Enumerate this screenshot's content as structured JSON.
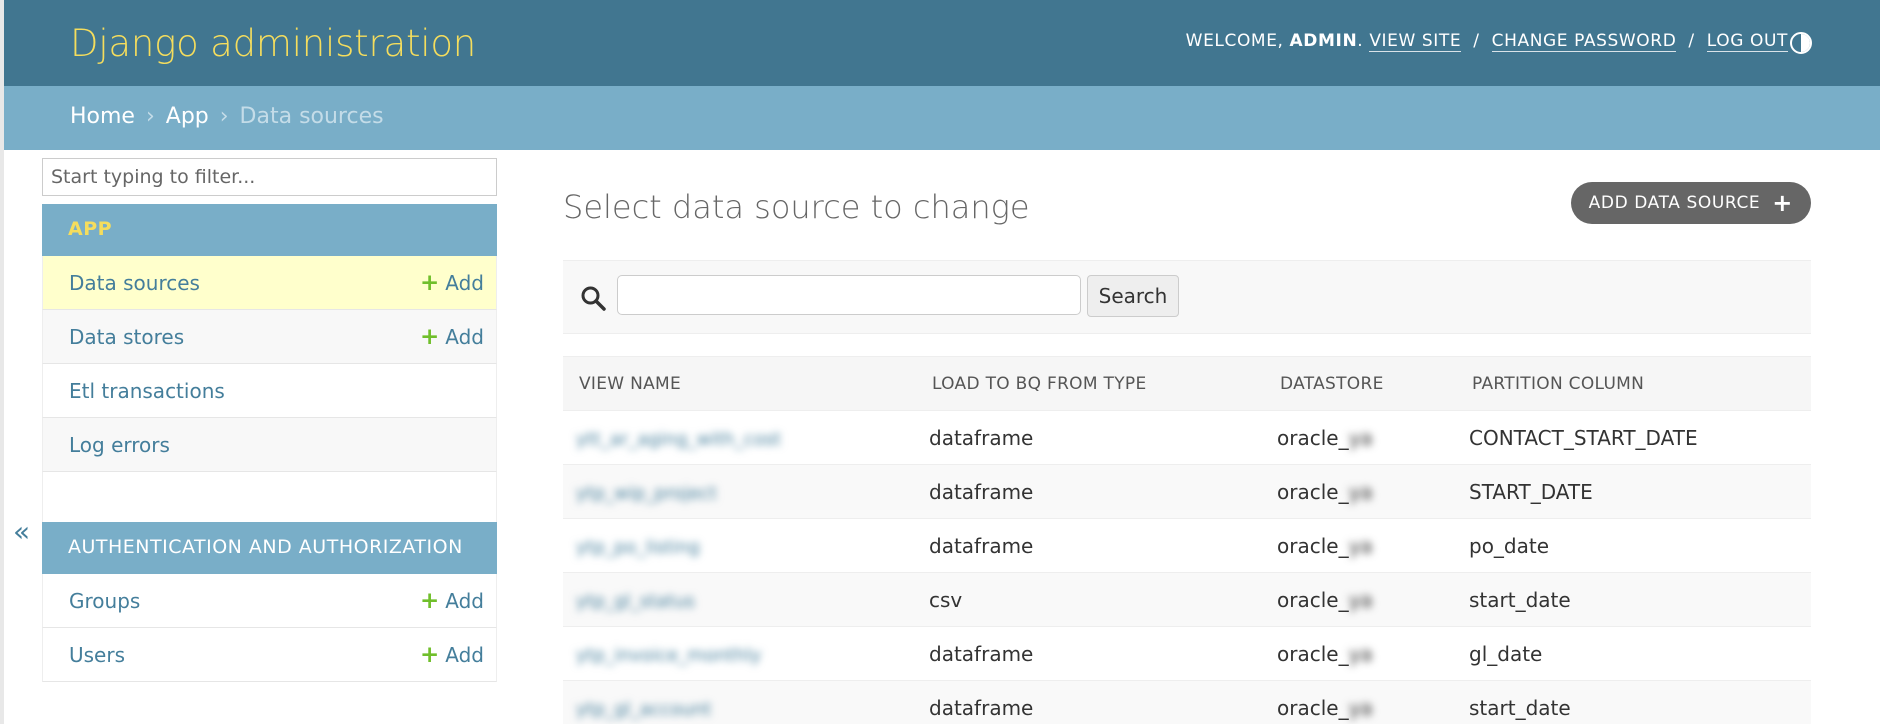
{
  "header": {
    "site_title": "Django administration",
    "welcome": "WELCOME, ",
    "username": "ADMIN",
    "links": [
      "VIEW SITE",
      "CHANGE PASSWORD",
      "LOG OUT"
    ]
  },
  "breadcrumbs": {
    "home": "Home",
    "app": "App",
    "current": "Data sources"
  },
  "sidebar": {
    "filter_placeholder": "Start typing to filter...",
    "toggle_glyph": "«",
    "add_label": "Add",
    "modules": [
      {
        "caption": "APP",
        "models": [
          "Data sources",
          "Data stores",
          "Etl transactions",
          "Log errors"
        ]
      },
      {
        "caption": "AUTHENTICATION AND AUTHORIZATION",
        "models": [
          "Groups",
          "Users"
        ]
      }
    ]
  },
  "content": {
    "title": "Select data source to change",
    "add_button": "ADD DATA SOURCE",
    "search_button": "Search",
    "columns": [
      "VIEW NAME",
      "LOAD TO BQ FROM TYPE",
      "DATASTORE",
      "PARTITION COLUMN"
    ],
    "rows": [
      {
        "view_name": "ytt_ar_aging_with_cost",
        "load_type": "dataframe",
        "datastore": "oracle_",
        "datastore_suffix": "ya",
        "partition": "CONTACT_START_DATE"
      },
      {
        "view_name": "ytp_wip_project",
        "load_type": "dataframe",
        "datastore": "oracle_",
        "datastore_suffix": "ya",
        "partition": "START_DATE"
      },
      {
        "view_name": "ytp_po_listing",
        "load_type": "dataframe",
        "datastore": "oracle_",
        "datastore_suffix": "ya",
        "partition": "po_date"
      },
      {
        "view_name": "ytp_gl_status",
        "load_type": "csv",
        "datastore": "oracle_",
        "datastore_suffix": "ya",
        "partition": "start_date"
      },
      {
        "view_name": "ytp_invoice_monthly",
        "load_type": "dataframe",
        "datastore": "oracle_",
        "datastore_suffix": "ya",
        "partition": "gl_date"
      },
      {
        "view_name": "ytp_gl_account",
        "load_type": "dataframe",
        "datastore": "oracle_",
        "datastore_suffix": "ya",
        "partition": "start_date"
      }
    ]
  },
  "colors": {
    "header_bg": "#417690",
    "breadcrumb_bg": "#79aec8",
    "title_yellow": "#f5dd5d",
    "link_blue": "#447e9b",
    "add_green": "#70bf2b",
    "current_row": "#ffffcc"
  },
  "icons": [
    "theme-toggle-icon",
    "search-icon",
    "plus-icon",
    "collapse-sidebar-icon"
  ]
}
